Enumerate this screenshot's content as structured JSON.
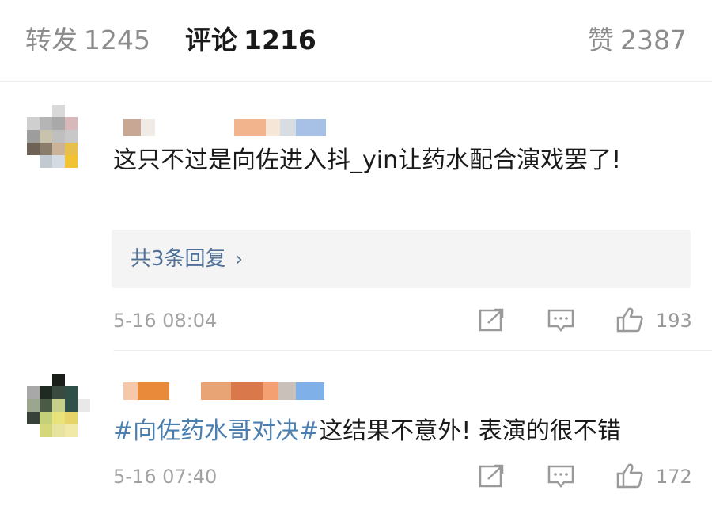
{
  "tabs": {
    "repost": {
      "label": "转发",
      "count": "1245"
    },
    "comments": {
      "label": "评论",
      "count": "1216"
    },
    "likes": {
      "label": "赞",
      "count": "2387"
    }
  },
  "comments": [
    {
      "text": "这只不过是向佐进入抖_yin让药水配合演戏罢了!",
      "replies_label": "共3条回复",
      "replies_chevron": "›",
      "timestamp": "5-16 08:04",
      "like_count": "193",
      "username_redacted": true,
      "avatar_pixelated": true
    },
    {
      "topic": "#向佐药水哥对决#",
      "text": "这结果不意外! 表演的很不错",
      "timestamp": "5-16 07:40",
      "like_count": "172",
      "username_redacted": true,
      "avatar_pixelated": true
    }
  ],
  "icons": [
    "share-icon",
    "comment-icon",
    "like-icon"
  ],
  "colors": {
    "topic": "#4a7fb0",
    "reply_link": "#4f6f97",
    "meta": "#a3a3a3"
  }
}
